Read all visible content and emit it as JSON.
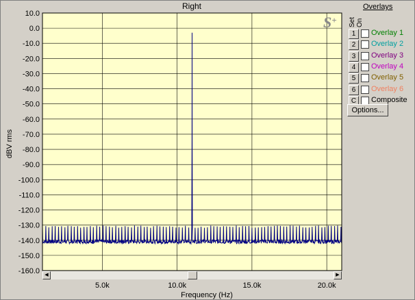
{
  "chart_data": {
    "type": "line",
    "title": "Right",
    "xlabel": "Frequency (Hz)",
    "ylabel": "dBV rms",
    "xlim": [
      1000,
      21000
    ],
    "ylim": [
      -160,
      10
    ],
    "x_ticks": [
      5000,
      10000,
      15000,
      20000
    ],
    "x_tick_labels": [
      "5.0k",
      "10.0k",
      "15.0k",
      "20.0k"
    ],
    "y_ticks": [
      10,
      0,
      -10,
      -20,
      -30,
      -40,
      -50,
      -60,
      -70,
      -80,
      -90,
      -100,
      -110,
      -120,
      -130,
      -140,
      -150,
      -160
    ],
    "y_tick_labels": [
      "10.0",
      "0.0",
      "-10.0",
      "-20.0",
      "-30.0",
      "-40.0",
      "-50.0",
      "-60.0",
      "-70.0",
      "-80.0",
      "-90.0",
      "-100.0",
      "-110.0",
      "-120.0",
      "-130.0",
      "-140.0",
      "-150.0",
      "-160.0"
    ],
    "grid": true,
    "series": [
      {
        "color": "#000080",
        "noise_floor_db": -141,
        "noise_spike_db": -131,
        "spike_spacing_hz": 212,
        "peak": {
          "x": 11000,
          "y": -3
        },
        "peak_shoulder_db": -72
      }
    ]
  },
  "logo": {
    "text": "S",
    "sup": "+"
  },
  "overlays": {
    "title": "Overlays",
    "col_set": "Set",
    "col_on": "On",
    "items": [
      {
        "btn": "1",
        "label": "Overlay 1",
        "color": "#008000"
      },
      {
        "btn": "2",
        "label": "Overlay 2",
        "color": "#00a0a0"
      },
      {
        "btn": "3",
        "label": "Overlay 3",
        "color": "#800080"
      },
      {
        "btn": "4",
        "label": "Overlay 4",
        "color": "#c000c0"
      },
      {
        "btn": "5",
        "label": "Overlay 5",
        "color": "#806000"
      },
      {
        "btn": "6",
        "label": "Overlay 6",
        "color": "#f08060"
      },
      {
        "btn": "C",
        "label": "Composite",
        "color": "#000000"
      }
    ],
    "options_label": "Options..."
  },
  "scrollbar": {
    "left_arrow": "◀",
    "right_arrow": "▶",
    "position": 0.5
  }
}
